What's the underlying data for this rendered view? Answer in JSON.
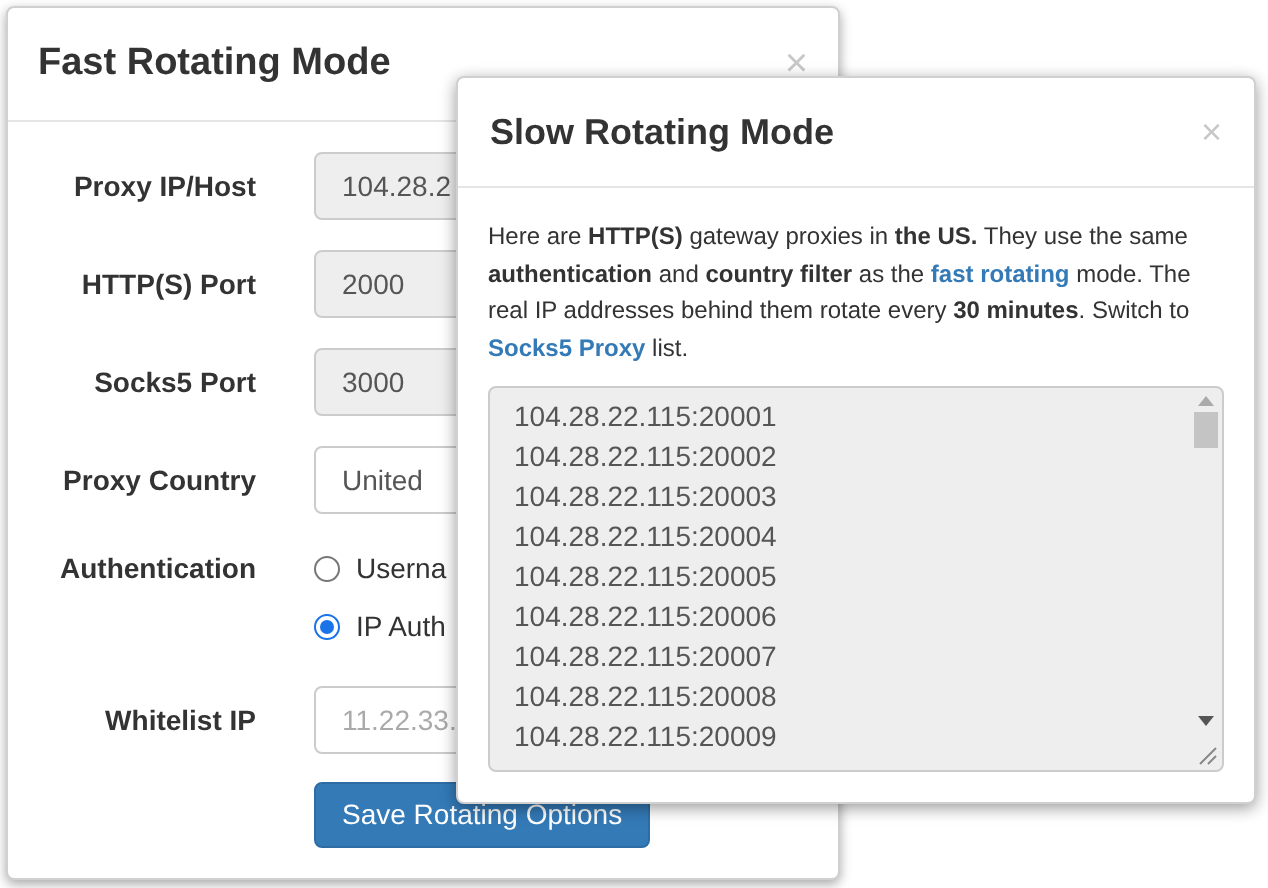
{
  "fast_mode": {
    "title": "Fast Rotating Mode",
    "close": "×",
    "fields": [
      {
        "kind": "readonly",
        "label": "Proxy IP/Host",
        "value": "104.28.2"
      },
      {
        "kind": "readonly",
        "label": "HTTP(S) Port",
        "value": "2000"
      },
      {
        "kind": "readonly",
        "label": "Socks5 Port",
        "value": "3000"
      },
      {
        "kind": "select",
        "label": "Proxy Country",
        "value": "United"
      },
      {
        "kind": "radio",
        "label": "Authentication",
        "options": [
          {
            "label": "Userna",
            "selected": false
          },
          {
            "label": "IP Auth",
            "selected": true
          }
        ]
      },
      {
        "kind": "input",
        "label": "Whitelist IP",
        "placeholder": "11.22.33."
      }
    ],
    "save_button": "Save Rotating Options"
  },
  "slow_mode": {
    "title": "Slow Rotating Mode",
    "close": "×",
    "description": [
      {
        "kind": "text",
        "text": "Here are **HTTP(S)** gateway proxies in **the US.** They use the same **authentication** and **country filter** as the "
      },
      {
        "kind": "link",
        "text": "fast rotating"
      },
      {
        "kind": "text",
        "text": " mode. The real IP addresses behind them rotate every **30 minutes**. Switch to "
      },
      {
        "kind": "link",
        "text": "Socks5 Proxy"
      },
      {
        "kind": "text",
        "text": " list."
      }
    ],
    "proxies": [
      "104.28.22.115:20001",
      "104.28.22.115:20002",
      "104.28.22.115:20003",
      "104.28.22.115:20004",
      "104.28.22.115:20005",
      "104.28.22.115:20006",
      "104.28.22.115:20007",
      "104.28.22.115:20008",
      "104.28.22.115:20009"
    ]
  }
}
